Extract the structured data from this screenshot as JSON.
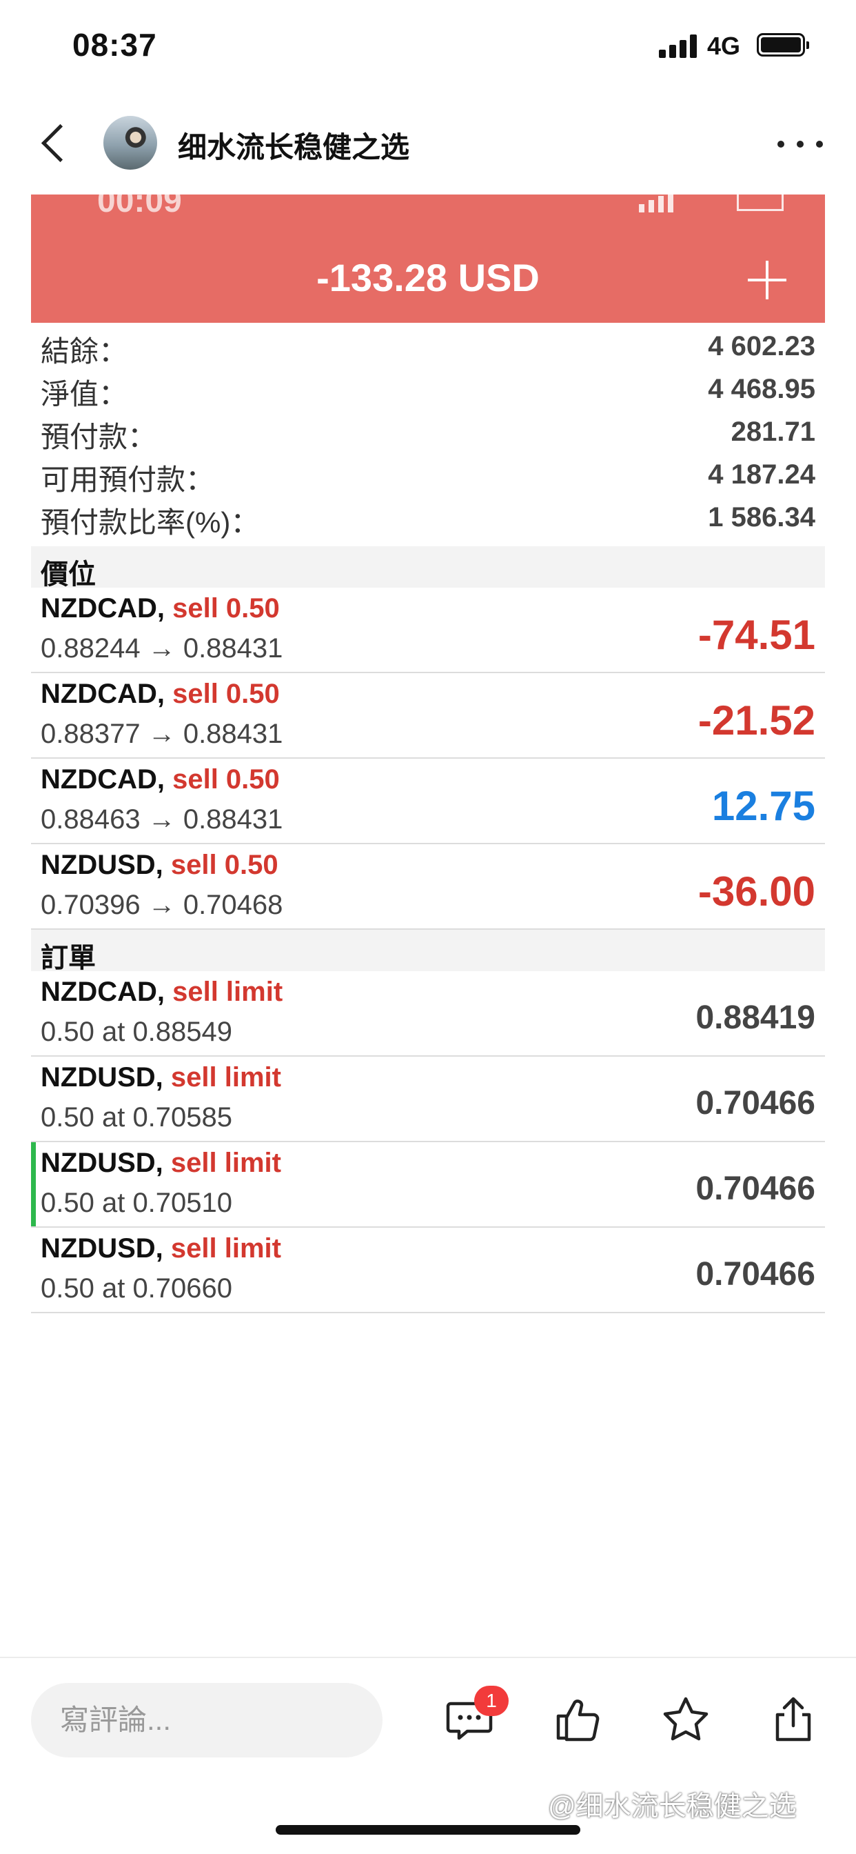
{
  "status_bar": {
    "time": "08:37",
    "network": "4G"
  },
  "nav": {
    "title": "细水流长稳健之选"
  },
  "inner_status": {
    "time": "00:09"
  },
  "header": {
    "total_profit": "-133.28 USD"
  },
  "summary": [
    {
      "label": "結餘：",
      "value": "4 602.23"
    },
    {
      "label": "淨值：",
      "value": "4 468.95"
    },
    {
      "label": "預付款：",
      "value": "281.71"
    },
    {
      "label": "可用預付款：",
      "value": "4 187.24"
    },
    {
      "label": "預付款比率(%)：",
      "value": "1 586.34"
    }
  ],
  "positions": {
    "title": "價位",
    "items": [
      {
        "symbol": "NZDCAD,",
        "side": " sell 0.50",
        "prices": "0.88244 → 0.88431",
        "profit": "-74.51",
        "color": "#d3382f"
      },
      {
        "symbol": "NZDCAD,",
        "side": " sell 0.50",
        "prices": "0.88377 → 0.88431",
        "profit": "-21.52",
        "color": "#d3382f"
      },
      {
        "symbol": "NZDCAD,",
        "side": " sell 0.50",
        "prices": "0.88463 → 0.88431",
        "profit": "12.75",
        "color": "#1a7fe0"
      },
      {
        "symbol": "NZDUSD,",
        "side": " sell 0.50",
        "prices": "0.70396 → 0.70468",
        "profit": "-36.00",
        "color": "#d3382f"
      }
    ]
  },
  "orders": {
    "title": "訂單",
    "items": [
      {
        "symbol": "NZDCAD,",
        "side": " sell limit",
        "detail": "0.50 at 0.88549",
        "price": "0.88419"
      },
      {
        "symbol": "NZDUSD,",
        "side": " sell limit",
        "detail": "0.50 at 0.70585",
        "price": "0.70466"
      },
      {
        "symbol": "NZDUSD,",
        "side": " sell limit",
        "detail": "0.50 at 0.70510",
        "price": "0.70466"
      },
      {
        "symbol": "NZDUSD,",
        "side": " sell limit",
        "detail": "0.50 at 0.70660",
        "price": "0.70466"
      }
    ]
  },
  "bottom": {
    "comment_placeholder": "寫評論...",
    "comment_badge": "1",
    "watermark": "@细水流长稳健之选"
  }
}
